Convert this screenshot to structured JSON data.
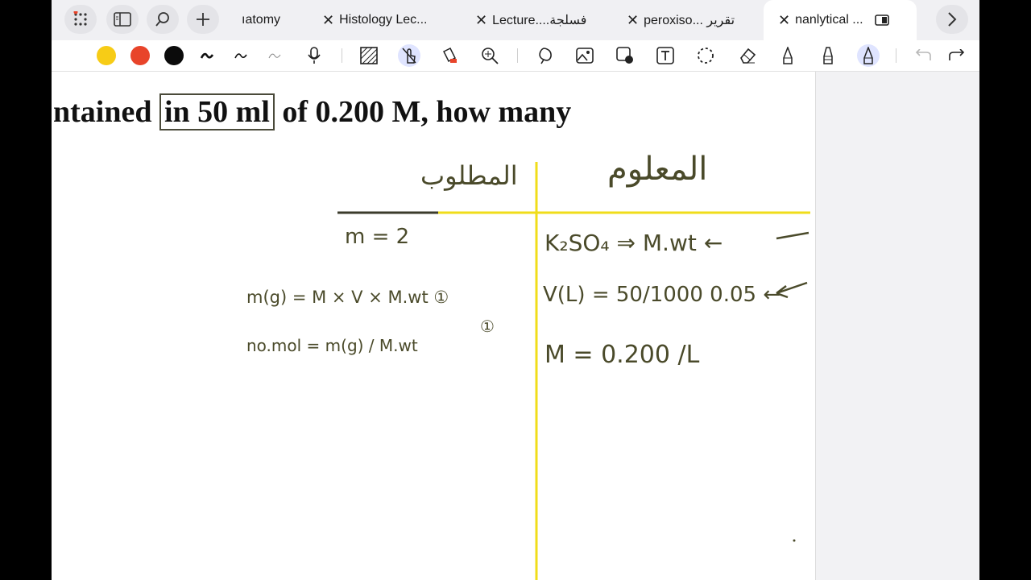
{
  "tabs": [
    {
      "label": "ıatomy",
      "close": false
    },
    {
      "label": "Histology Lec...",
      "close": true
    },
    {
      "label": "Lecture....فسلجة",
      "close": true
    },
    {
      "label": "peroxiso... تقرير",
      "close": true
    },
    {
      "label": "nanlytical ...",
      "close": true,
      "active": true
    }
  ],
  "tab_close_glyph": "✕",
  "toolbar": {
    "colors": [
      "#f7cc16",
      "#e8442a",
      "#0b0b0b"
    ],
    "icons": [
      "pen-icon",
      "pen-medium-icon",
      "pen-thin-icon",
      "microphone-icon",
      "pattern-fill-icon",
      "touch-draw-icon",
      "highlighter-icon",
      "zoom-icon",
      "lasso-icon",
      "image-icon",
      "shape-icon",
      "text-box-icon",
      "dashed-circle-icon",
      "eraser-icon",
      "pencil-icon",
      "marker-icon",
      "selected-marker-icon",
      "undo-icon",
      "redo-icon"
    ]
  },
  "document": {
    "question_before": "ntained",
    "question_boxed": "in 50 ml",
    "question_after": "of 0.200 M, how many"
  },
  "notes": {
    "right_header": "المعلوم",
    "left_header": "المطلوب",
    "left_lines": [
      "m = 2",
      "m(g) = M × V × M.wt ①",
      "no.mol = m(g) / M.wt",
      "①"
    ],
    "right_lines": [
      "K₂SO₄ ⇒ M.wt ←",
      "V(L) = 50/1000 0.05 ←",
      "M = 0.200 /L"
    ]
  },
  "colors": {
    "ink": "#4a4a2a",
    "divider": "#f0dd1a",
    "accent": "#dfe4ff"
  }
}
